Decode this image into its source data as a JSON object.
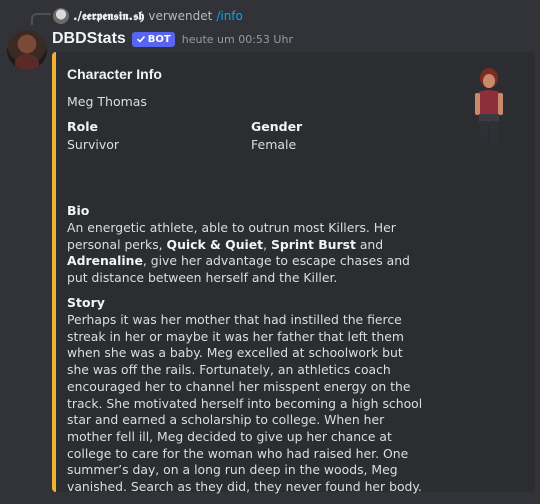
{
  "reply": {
    "user": "./𝖊𝖊𝖗𝖕𝖊𝖓𝖘𝖎𝖓.𝖘𝖍",
    "used": "verwendet",
    "command": "/info"
  },
  "message": {
    "username": "DBDStats",
    "bot_badge": "BOT",
    "timestamp": "heute um 00:53 Uhr"
  },
  "embed": {
    "accent": "#f0b232",
    "title": "Character Info",
    "description": "Meg Thomas",
    "fields": [
      {
        "name": "Role",
        "value": "Survivor"
      },
      {
        "name": "Gender",
        "value": "Female"
      }
    ],
    "bio_title": "Bio",
    "bio": {
      "p1": "An energetic athlete, able to outrun most Killers. Her personal perks, ",
      "perk1": "Quick & Quiet",
      "sep1": ", ",
      "perk2": "Sprint Burst",
      "sep2": " and ",
      "perk3": "Adrenaline",
      "p2": ", give her advantage to escape chases and put distance between herself and the Killer."
    },
    "story_title": "Story",
    "story": "Perhaps it was her mother that had instilled the fierce streak in her or maybe it was her father that left them when she was a baby. Meg excelled at schoolwork but she was off the rails. Fortunately, an athletics coach encouraged her to channel her misspent energy on the track. She motivated herself into becoming a high school star and earned a scholarship to college. When her mother fell ill, Meg decided to give up her chance at college to care for the woman who had raised her. One summer’s day, on a long run deep in the woods, Meg vanished. Search as they did, they never found her body."
  }
}
